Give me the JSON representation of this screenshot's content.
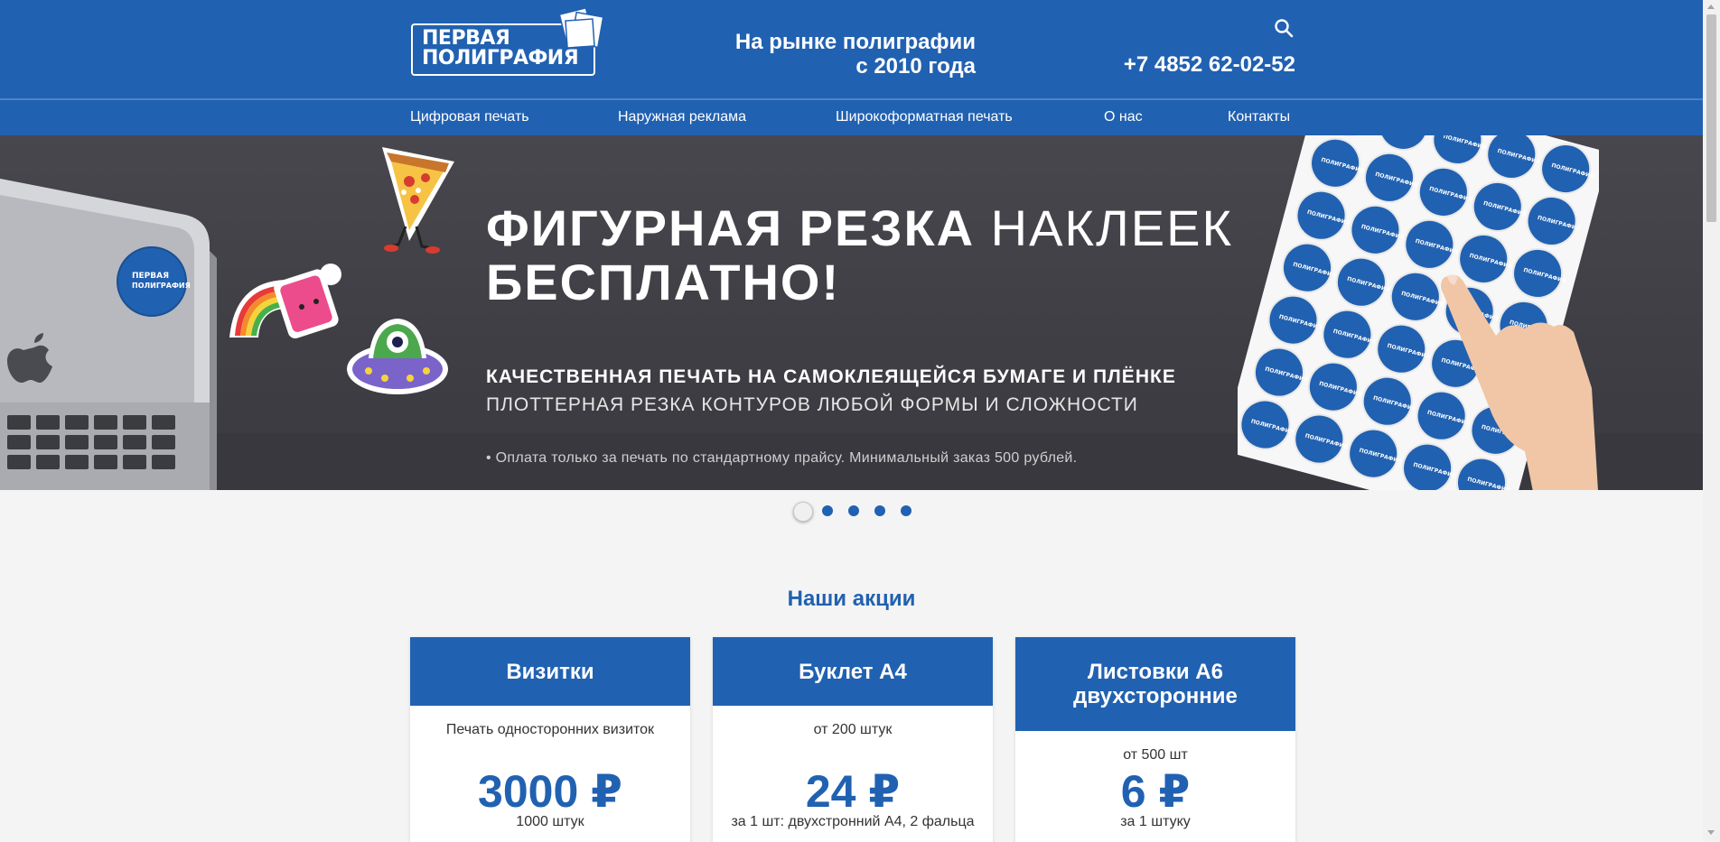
{
  "header": {
    "logo_line1": "Первая",
    "logo_line2": "Полиграфия",
    "tagline_line1": "На рынке полиграфии",
    "tagline_line2": "с 2010 года",
    "phone": "+7 4852 62-02-52",
    "search_icon": "search-icon"
  },
  "nav": {
    "items": [
      {
        "label": "Цифровая печать"
      },
      {
        "label": "Наружная реклама"
      },
      {
        "label": "Широкоформатная печать"
      },
      {
        "label": "О нас"
      },
      {
        "label": "Контакты"
      }
    ]
  },
  "banner": {
    "title_bold": "ФИГУРНАЯ РЕЗКА",
    "title_light": "НАКЛЕЕК",
    "title_line2": "БЕСПЛАТНО!",
    "subtitle1": "КАЧЕСТВЕННАЯ ПЕЧАТЬ НА САМОКЛЕЯЩЕЙСЯ БУМАГЕ И ПЛЁНКЕ",
    "subtitle2": "ПЛОТТЕРНАЯ РЕЗКА КОНТУРОВ ЛЮБОЙ ФОРМЫ И СЛОЖНОСТИ",
    "note": "•  Оплата только за печать по стандартному прайсу. Минимальный заказ 500 рублей.",
    "sticker_text": "ПЕРВАЯ ПОЛИГРАФИЯ"
  },
  "slider": {
    "total": 5,
    "active_index": 0
  },
  "promotions": {
    "title": "Наши акции",
    "cards": [
      {
        "title": "Визитки",
        "subtitle": "Печать односторонних визиток",
        "price": "3000 ₽",
        "note": "1000 штук"
      },
      {
        "title": "Буклет А4",
        "subtitle": "от 200 штук",
        "price": "24 ₽",
        "note": "за 1 шт: двухстронний А4, 2 фальца"
      },
      {
        "title": "Листовки А6 двухсторонние",
        "subtitle": "от 500 шт",
        "price": "6 ₽",
        "note": "за 1 штуку"
      }
    ]
  },
  "colors": {
    "brand_blue": "#2161b1",
    "banner_bg": "#45454b",
    "page_bg": "#f4f4f4"
  }
}
